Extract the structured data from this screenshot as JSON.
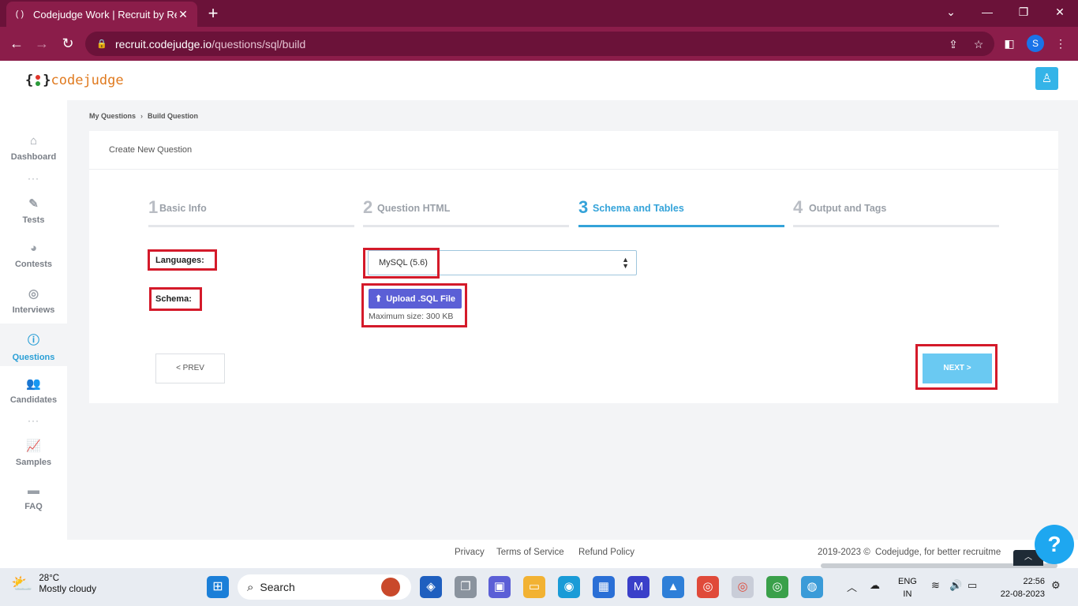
{
  "browser": {
    "tab_title": "Codejudge Work | Recruit by Rea",
    "url_host": "recruit.codejudge.io",
    "url_path": "/questions/sql/build",
    "profile_initial": "S"
  },
  "app": {
    "logo_text": "codejudge"
  },
  "sidebar": {
    "items": [
      {
        "label": "Dashboard",
        "icon": "home-icon"
      },
      {
        "label": "Tests",
        "icon": "pencil-icon"
      },
      {
        "label": "Contests",
        "icon": "pie-chart-icon"
      },
      {
        "label": "Interviews",
        "icon": "podcast-icon"
      },
      {
        "label": "Questions",
        "icon": "question-circle-icon"
      },
      {
        "label": "Candidates",
        "icon": "users-icon"
      },
      {
        "label": "Samples",
        "icon": "line-chart-icon"
      },
      {
        "label": "FAQ",
        "icon": "chat-icon"
      }
    ]
  },
  "breadcrumb": {
    "first": "My Questions",
    "separator": "›",
    "second": "Build Question"
  },
  "card": {
    "title": "Create New Question"
  },
  "steps": [
    {
      "num": "1",
      "label": "Basic Info"
    },
    {
      "num": "2",
      "label": "Question HTML"
    },
    {
      "num": "3",
      "label": "Schema and Tables"
    },
    {
      "num": "4",
      "label": "Output and Tags"
    }
  ],
  "form": {
    "languages_label": "Languages:",
    "languages_value": "MySQL (5.6)",
    "schema_label": "Schema:",
    "upload_label": "Upload .SQL File",
    "max_size": "Maximum size: 300 KB",
    "prev_label": "< PREV",
    "next_label": "NEXT >"
  },
  "footer": {
    "privacy": "Privacy",
    "terms": "Terms of Service",
    "refund": "Refund Policy",
    "copyright": "2019-2023 ©  Codejudge, for better recruitme"
  },
  "help_label": "?",
  "taskbar": {
    "temp": "28°C",
    "weather": "Mostly cloudy",
    "search_label": "Search",
    "lang_top": "ENG",
    "lang_bottom": "IN",
    "time": "22:56",
    "date": "22-08-2023"
  },
  "colors": {
    "chrome_frame": "#6b1239",
    "chrome_toolbar": "#8b1d4a",
    "accent": "#34a3d9",
    "highlight_box": "#d41a2a",
    "upload_button": "#5b5fd6",
    "next_button": "#6ac9f2"
  }
}
